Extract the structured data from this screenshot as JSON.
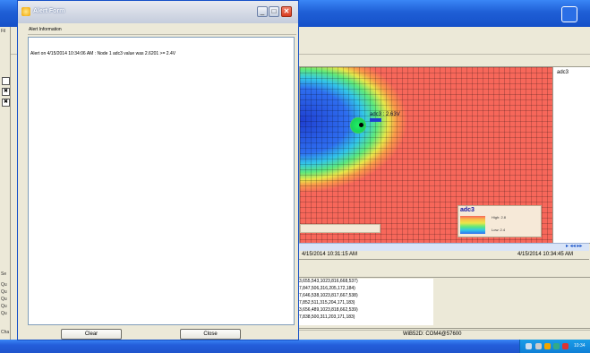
{
  "background_app": {
    "left_strip_letters": [
      "Fil",
      "Se",
      "Qu",
      "Qu",
      "Qu",
      "Qu",
      "Qu",
      "Cha"
    ],
    "left_checkbox_marks": [
      "",
      "✖",
      "✖"
    ],
    "heatmap": {
      "sensor_label": "adc3 : 2.63V",
      "right_panel_label": "adc3",
      "legend": {
        "title": "adc3",
        "high": "High: 2.8",
        "low": "Low: 2.4"
      },
      "colors": {
        "low": "#1f3fd1",
        "mid": "#5ee87c",
        "high": "#f7675a"
      }
    },
    "timeline": {
      "start": "4/15/2014 10:31:15 AM",
      "end": "4/15/2014 10:34:45 AM"
    },
    "data_lines": [
      "3,655,543,1023,816,668,537)",
      "7,847,506,316,205,172,184)",
      "7,646,538,1023,817,667,538)",
      "7,852,511,315,204,171,183)",
      "3,656,489,1023,818,662,539)",
      "7,838,500,311,203,171,183)"
    ],
    "status_text": "WiB52D: COM4@57600",
    "taskbar": {
      "clock": "10:34"
    }
  },
  "alert_form": {
    "title": "Alert Form",
    "group_label": "Alert Information",
    "message": "Alert on 4/15/2014 10:34:06 AM : Node 1 adc3 value was 2.6201 >= 2.4V",
    "buttons": {
      "clear": "Clear",
      "close": "Close"
    },
    "title_buttons": {
      "minimize": "_",
      "maximize": "□",
      "close": "✕"
    }
  }
}
